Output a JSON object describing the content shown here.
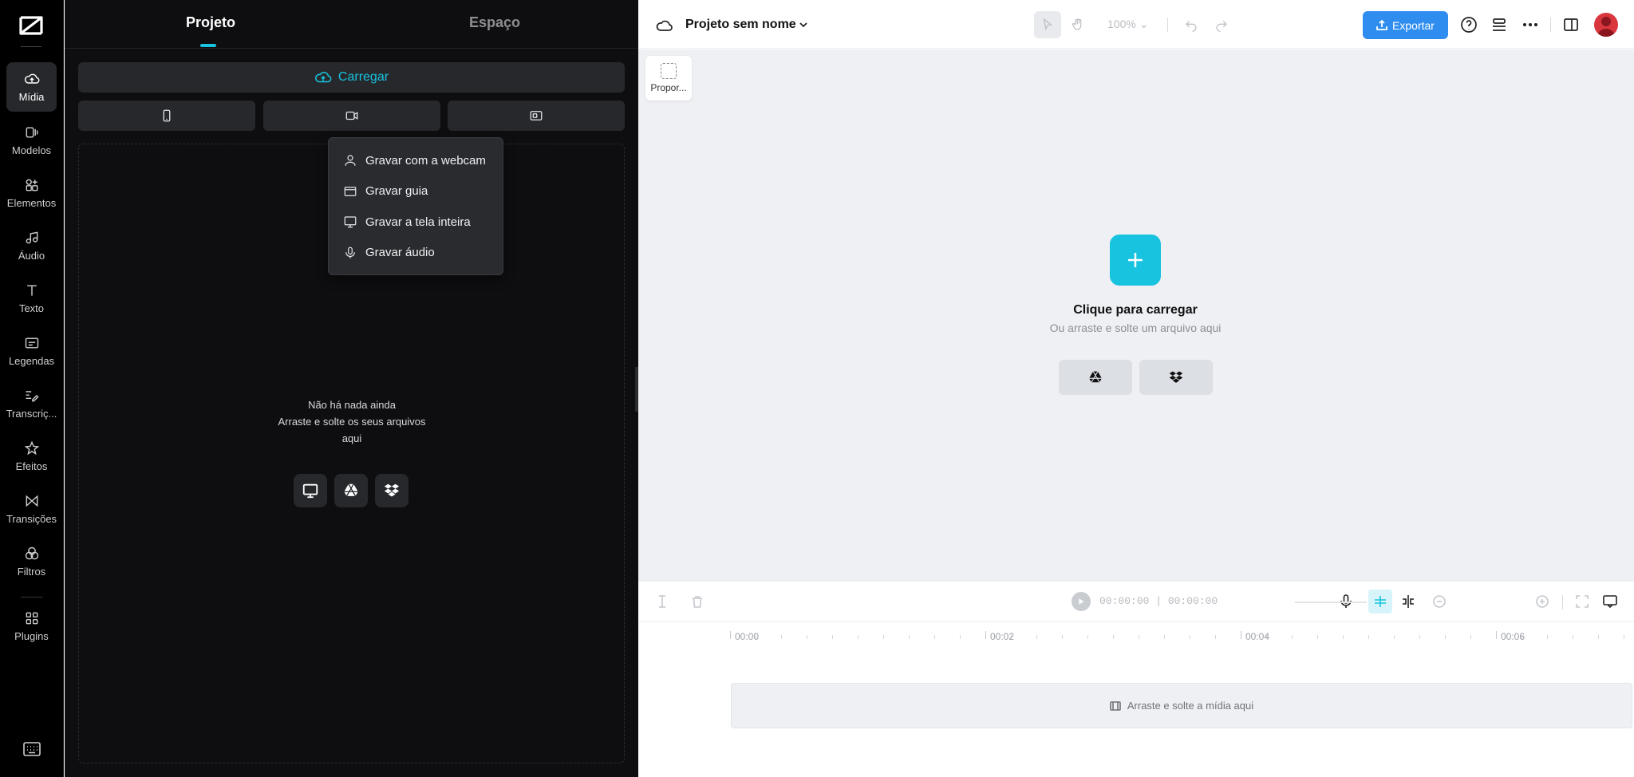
{
  "rail": {
    "items": [
      {
        "label": "Mídia",
        "icon": "cloud-upload-icon"
      },
      {
        "label": "Modelos",
        "icon": "templates-icon"
      },
      {
        "label": "Elementos",
        "icon": "elements-icon"
      },
      {
        "label": "Áudio",
        "icon": "music-note-icon"
      },
      {
        "label": "Texto",
        "icon": "text-icon"
      },
      {
        "label": "Legendas",
        "icon": "captions-icon"
      },
      {
        "label": "Transcriç...",
        "icon": "transcript-icon"
      },
      {
        "label": "Efeitos",
        "icon": "effects-icon"
      },
      {
        "label": "Transições",
        "icon": "transitions-icon"
      },
      {
        "label": "Filtros",
        "icon": "filters-icon"
      },
      {
        "label": "Plugins",
        "icon": "plugins-icon"
      }
    ]
  },
  "panel": {
    "tabs": [
      "Projeto",
      "Espaço"
    ],
    "upload_label": "Carregar",
    "empty_line1": "Não há nada ainda",
    "empty_line2": "Arraste e solte os seus arquivos aqui"
  },
  "menu": {
    "items": [
      "Gravar com a webcam",
      "Gravar guia",
      "Gravar a tela inteira",
      "Gravar áudio"
    ]
  },
  "topbar": {
    "project_name": "Projeto sem nome",
    "zoom": "100%",
    "export_label": "Exportar"
  },
  "canvas": {
    "ratio_label": "Propor...",
    "click_title": "Clique para carregar",
    "click_sub": "Ou arraste e solte um arquivo aqui"
  },
  "timeline": {
    "current_time": "00:00:00",
    "total_time": "00:00:00",
    "ruler_labels": [
      "00:00",
      "00:02",
      "00:04",
      "00:06"
    ],
    "track_hint": "Arraste e solte a mídia aqui"
  },
  "colors": {
    "accent": "#18c3df",
    "export_blue": "#2f8df0",
    "panel_bg": "#0e0e10"
  }
}
